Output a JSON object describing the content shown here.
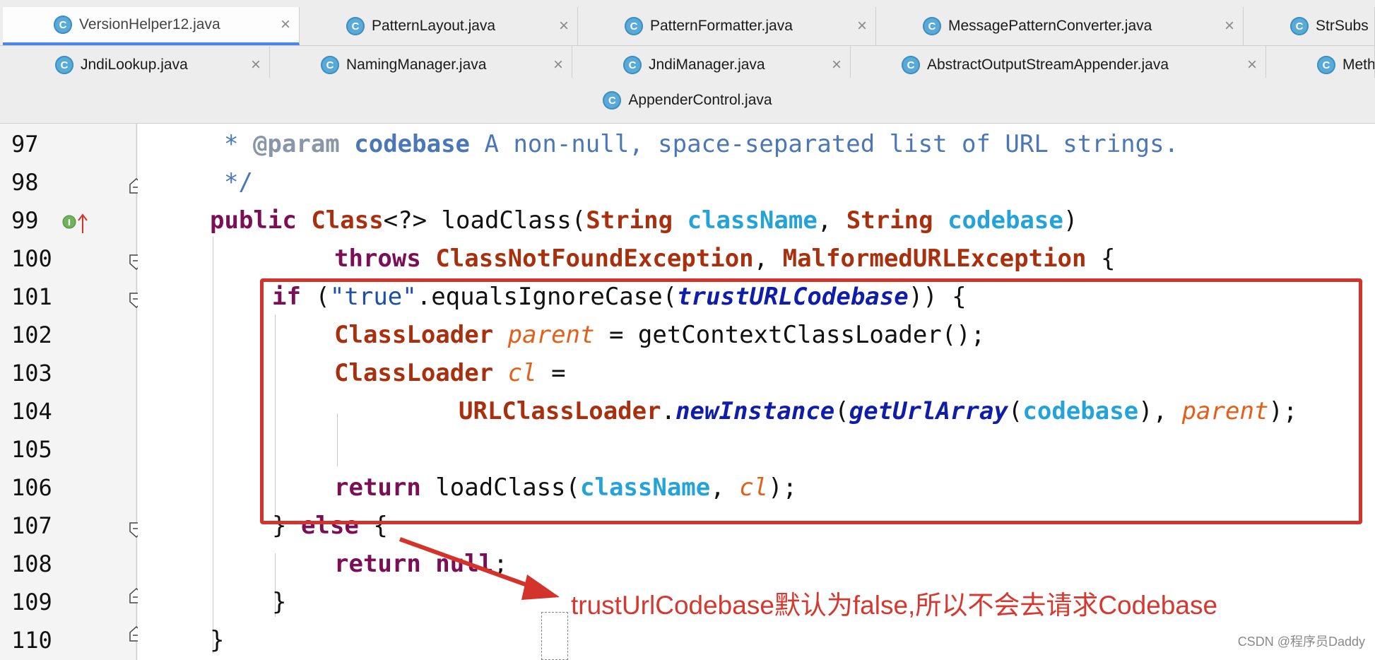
{
  "tabs_row1": [
    {
      "label": "VersionHelper12.java",
      "active": true
    },
    {
      "label": "PatternLayout.java",
      "active": false
    },
    {
      "label": "PatternFormatter.java",
      "active": false
    },
    {
      "label": "MessagePatternConverter.java",
      "active": false
    },
    {
      "label": "StrSubs",
      "active": false
    }
  ],
  "tabs_row2": [
    {
      "label": "JndiLookup.java"
    },
    {
      "label": "NamingManager.java"
    },
    {
      "label": "JndiManager.java"
    },
    {
      "label": "AbstractOutputStreamAppender.java"
    },
    {
      "label": "Meth"
    }
  ],
  "tabs_row3": [
    {
      "label": "AppenderControl.java"
    }
  ],
  "tab_icon_letter": "C",
  "close_glyph": "×",
  "line_numbers": [
    "97",
    "98",
    "99",
    "100",
    "101",
    "102",
    "103",
    "104",
    "105",
    "106",
    "107",
    "108",
    "109",
    "110"
  ],
  "code": {
    "l97": {
      "star": "* ",
      "tag": "@param",
      "name": "codebase",
      "desc": " A non-null, space-separated list of URL strings."
    },
    "l98": {
      "end": "*/"
    },
    "l99": {
      "public": "public",
      "cls": "Class",
      "gen": "<?> loadClass(",
      "t1": "String",
      "p1": "className",
      "comma": ", ",
      "t2": "String",
      "p2": "codebase",
      "close": ")"
    },
    "l100": {
      "throws": "throws",
      "e1": "ClassNotFoundException",
      "comma": ", ",
      "e2": "MalformedURLException",
      "brace": " {"
    },
    "l101": {
      "if": "if",
      "open": " (",
      "str": "\"true\"",
      "call": ".equalsIgnoreCase(",
      "fld": "trustURLCodebase",
      "close": ")) {"
    },
    "l102": {
      "type": "ClassLoader",
      "var": "parent",
      "rest": " = getContextClassLoader();"
    },
    "l103": {
      "type": "ClassLoader",
      "var": "cl",
      "rest": " ="
    },
    "l104": {
      "type": "URLClassLoader",
      "dot": ".",
      "m1": "newInstance",
      "o1": "(",
      "m2": "getUrlArray",
      "o2": "(",
      "p": "codebase",
      "c1": "), ",
      "v": "parent",
      "c2": ");"
    },
    "l106": {
      "ret": "return",
      "call": " loadClass(",
      "p": "className",
      "comma": ", ",
      "v": "cl",
      "close": ");"
    },
    "l107": {
      "close": "} ",
      "else": "else",
      "brace": " {"
    },
    "l108": {
      "ret": "return",
      "null": " null",
      "semi": ";"
    },
    "l109": {
      "brace": "}"
    },
    "l110": {
      "brace": "}"
    }
  },
  "annotation": "trustUrlCodebase默认为false,所以不会去请求Codebase",
  "watermark": "CSDN @程序员Daddy",
  "colors": {
    "highlight_box": "#d3332b",
    "annotation_text": "#d6382f",
    "active_tab_underline": "#4a86e8"
  }
}
